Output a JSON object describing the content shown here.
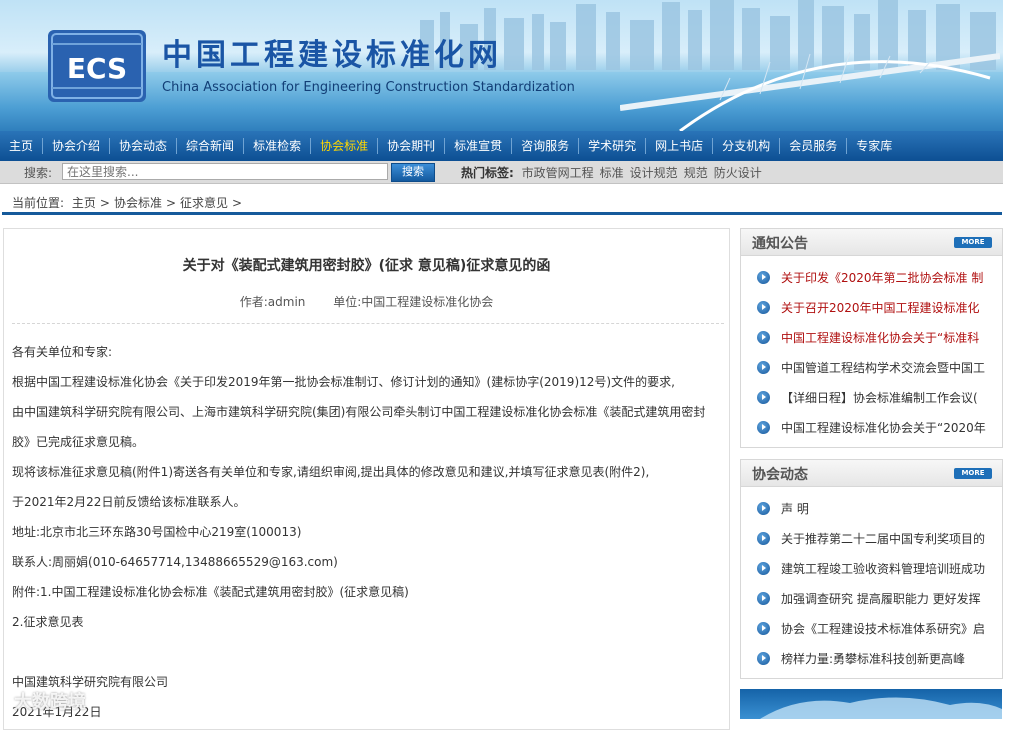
{
  "header": {
    "logo_text": "ECS",
    "site_title": "中国工程建设标准化网",
    "site_subtitle": "China Association for Engineering Construction Standardization"
  },
  "nav": {
    "items": [
      {
        "label": "主页"
      },
      {
        "label": "协会介绍"
      },
      {
        "label": "协会动态"
      },
      {
        "label": "综合新闻"
      },
      {
        "label": "标准检索"
      },
      {
        "label": "协会标准",
        "active": true
      },
      {
        "label": "协会期刊"
      },
      {
        "label": "标准宣贯"
      },
      {
        "label": "咨询服务"
      },
      {
        "label": "学术研究"
      },
      {
        "label": "网上书店"
      },
      {
        "label": "分支机构"
      },
      {
        "label": "会员服务"
      },
      {
        "label": "专家库"
      }
    ]
  },
  "search": {
    "label": "搜索:",
    "placeholder": "在这里搜索...",
    "button_label": "搜索",
    "hot_label": "热门标签:",
    "hot_tags": [
      "市政管网工程",
      "标准",
      "设计规范",
      "规范",
      "防火设计"
    ]
  },
  "breadcrumb": {
    "prefix": "当前位置:",
    "items": [
      "主页",
      ">",
      "协会标准",
      ">",
      "征求意见",
      ">"
    ]
  },
  "article": {
    "title": "关于对《装配式建筑用密封胶》(征求 意见稿)征求意见的函",
    "author": "作者:admin",
    "unit": "单位:中国工程建设标准化协会",
    "lines": [
      "各有关单位和专家:",
      "根据中国工程建设标准化协会《关于印发2019年第一批协会标准制订、修订计划的通知》(建标协字(2019)12号)文件的要求,",
      "由中国建筑科学研究院有限公司、上海市建筑科学研究院(集团)有限公司牵头制订中国工程建设标准化协会标准《装配式建筑用密封",
      "胶》已完成征求意见稿。",
      "现将该标准征求意见稿(附件1)寄送各有关单位和专家,请组织审阅,提出具体的修改意见和建议,并填写征求意见表(附件2),",
      "于2021年2月22日前反馈给该标准联系人。",
      "地址:北京市北三环东路30号国检中心219室(100013)",
      "联系人:周丽娟(010-64657714,13488665529@163.com)",
      "附件:1.中国工程建设标准化协会标准《装配式建筑用密封胶》(征求意见稿)",
      "2.征求意见表",
      "",
      "中国建筑科学研究院有限公司",
      "2021年1月22日"
    ]
  },
  "notice_panel": {
    "title": "通知公告",
    "more_label": "MORE",
    "items": [
      {
        "text": "关于印发《2020年第二批协会标准 制",
        "red": true
      },
      {
        "text": "关于召开2020年中国工程建设标准化",
        "red": true
      },
      {
        "text": "中国工程建设标准化协会关于“标准科",
        "red": true
      },
      {
        "text": "中国管道工程结构学术交流会暨中国工",
        "red": false
      },
      {
        "text": "【详细日程】协会标准编制工作会议(",
        "red": false
      },
      {
        "text": "中国工程建设标准化协会关于“2020年",
        "red": false
      }
    ]
  },
  "news_panel": {
    "title": "协会动态",
    "more_label": "MORE",
    "items": [
      {
        "text": "声 明"
      },
      {
        "text": "关于推荐第二十二届中国专利奖项目的"
      },
      {
        "text": "建筑工程竣工验收资料管理培训班成功"
      },
      {
        "text": "加强调查研究 提高履职能力 更好发挥"
      },
      {
        "text": "协会《工程建设技术标准体系研究》启"
      },
      {
        "text": "榜样力量:勇攀标准科技创新更高峰"
      }
    ]
  },
  "watermark": "大数跨境"
}
